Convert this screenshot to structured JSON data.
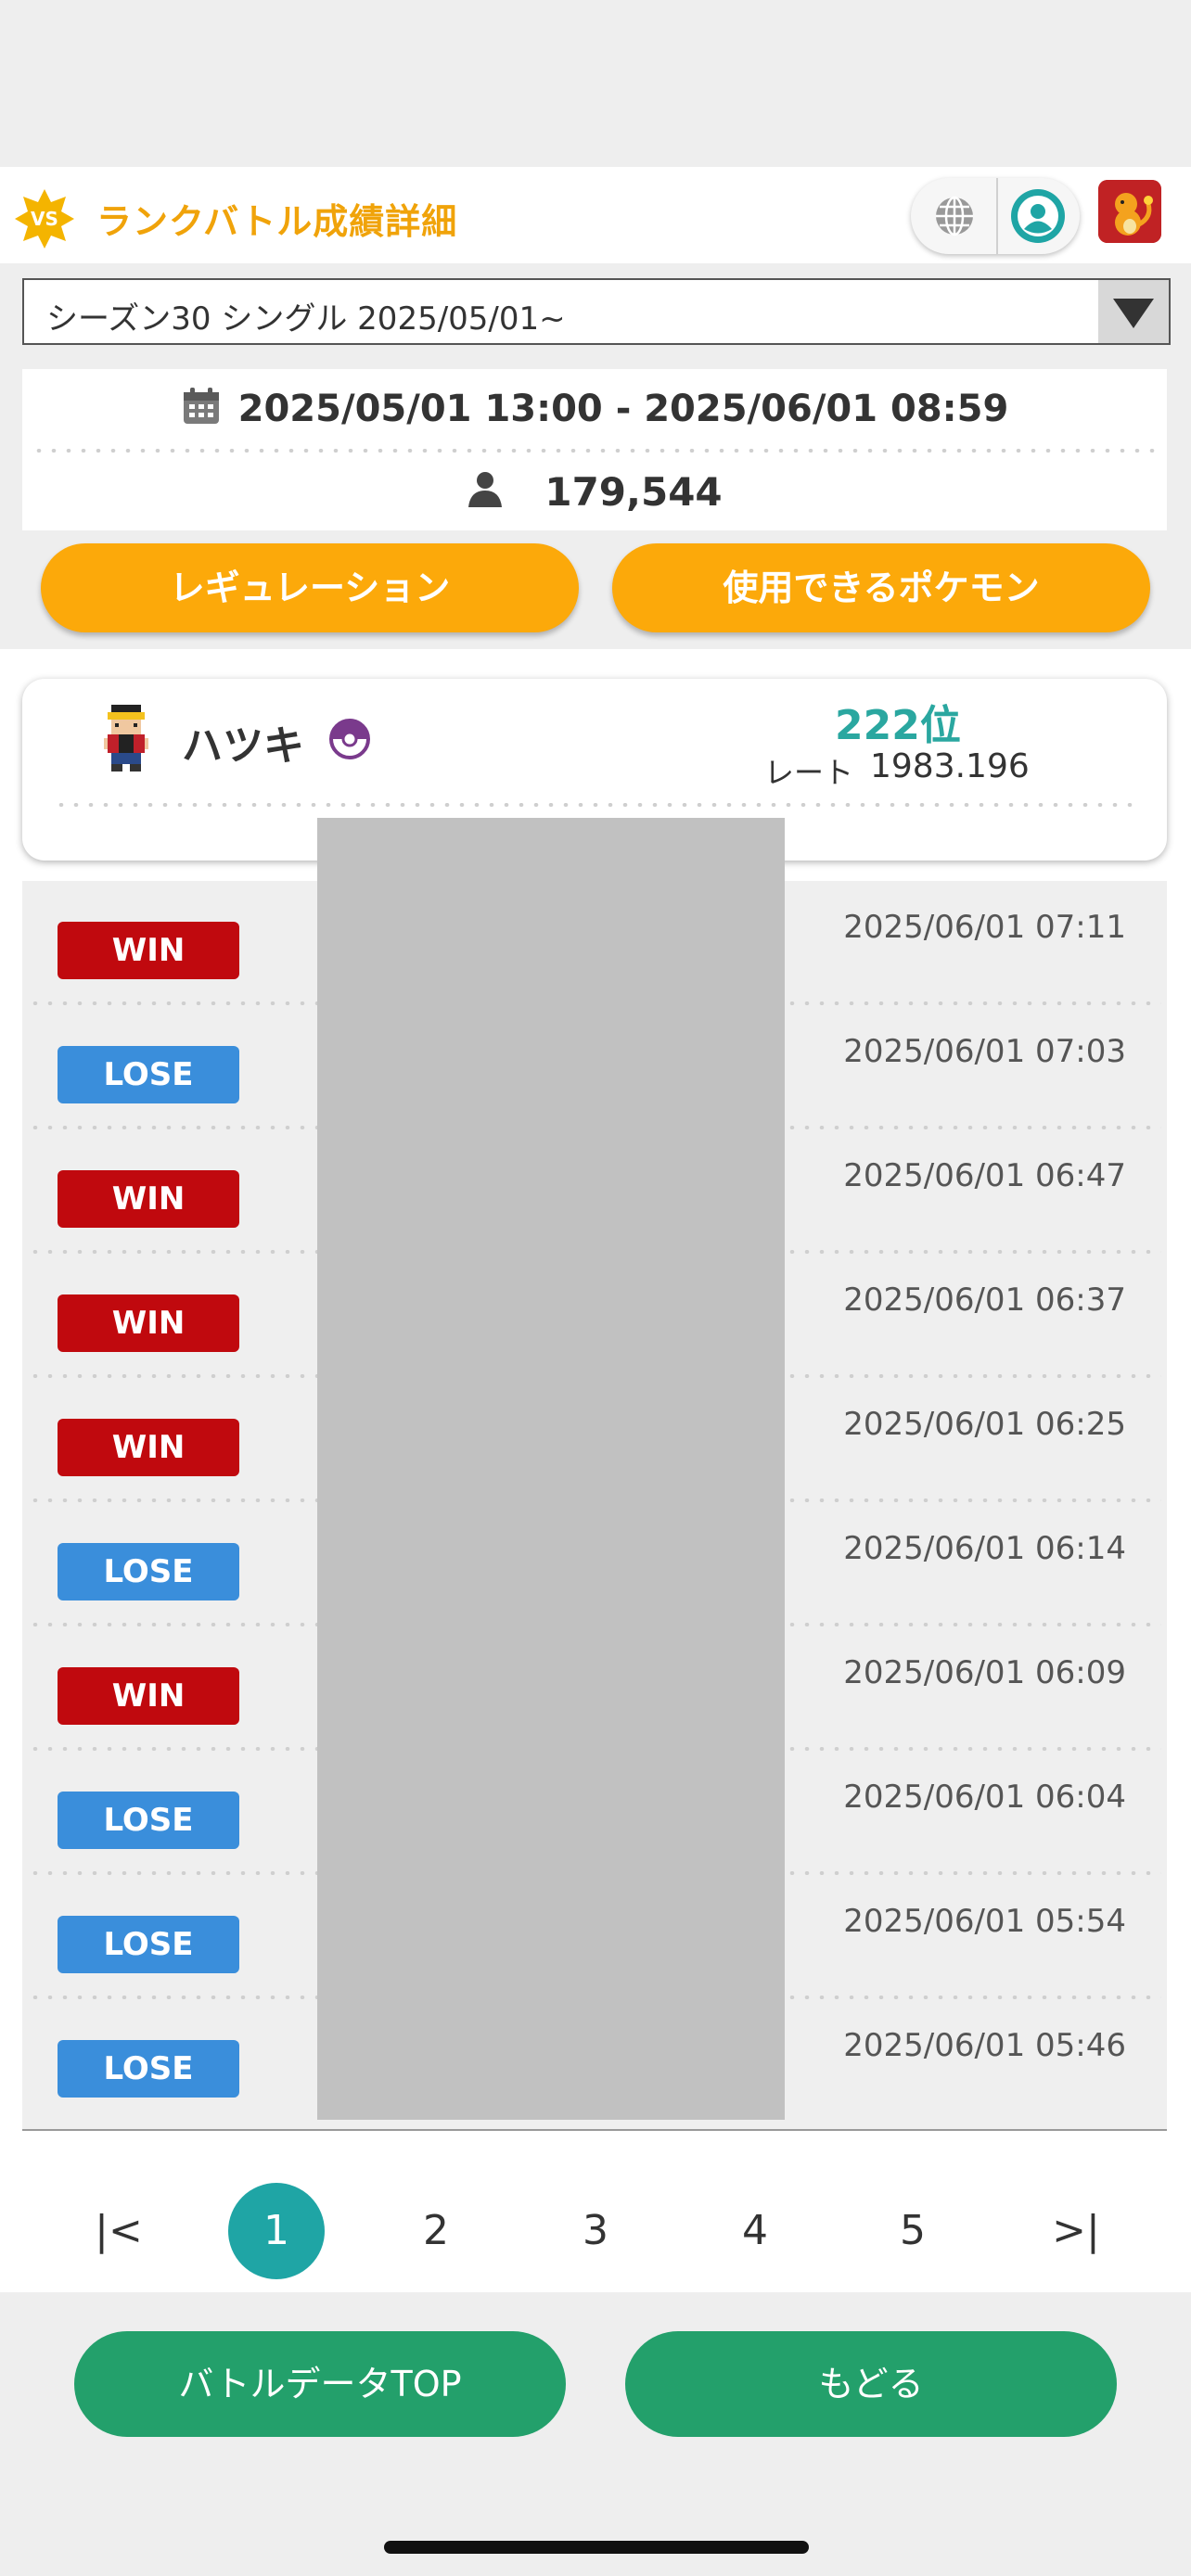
{
  "header": {
    "title": "ランクバトル成績詳細",
    "vs_label": "VS",
    "globe_icon": "globe-icon",
    "user_icon": "user-circle-icon",
    "accent_color": "#f0a30a"
  },
  "season_select": {
    "value": "シーズン30 シングル 2025/05/01~"
  },
  "info": {
    "period": "2025/05/01 13:00 - 2025/06/01 08:59",
    "participants": "179,544"
  },
  "buttons": {
    "regulation": "レギュレーション",
    "usable_pokemon": "使用できるポケモン",
    "battle_data_top": "バトルデータTOP",
    "back": "もどる"
  },
  "profile": {
    "name": "ハツキ",
    "rank": "222位",
    "rate_label": "レート",
    "rate_value": "1983.196"
  },
  "battles": [
    {
      "result": "WIN",
      "time": "2025/06/01 07:11"
    },
    {
      "result": "LOSE",
      "time": "2025/06/01 07:03"
    },
    {
      "result": "WIN",
      "time": "2025/06/01 06:47"
    },
    {
      "result": "WIN",
      "time": "2025/06/01 06:37"
    },
    {
      "result": "WIN",
      "time": "2025/06/01 06:25"
    },
    {
      "result": "LOSE",
      "time": "2025/06/01 06:14"
    },
    {
      "result": "WIN",
      "time": "2025/06/01 06:09"
    },
    {
      "result": "LOSE",
      "time": "2025/06/01 06:04"
    },
    {
      "result": "LOSE",
      "time": "2025/06/01 05:54"
    },
    {
      "result": "LOSE",
      "time": "2025/06/01 05:46"
    }
  ],
  "pagination": {
    "first": "|<",
    "pages": [
      "1",
      "2",
      "3",
      "4",
      "5"
    ],
    "active": "1",
    "last": ">|"
  },
  "colors": {
    "win": "#c0090e",
    "lose": "#3a8edb",
    "rank": "#2aa7a0",
    "green_button": "#23a06b",
    "orange_button": "#fca90a"
  }
}
